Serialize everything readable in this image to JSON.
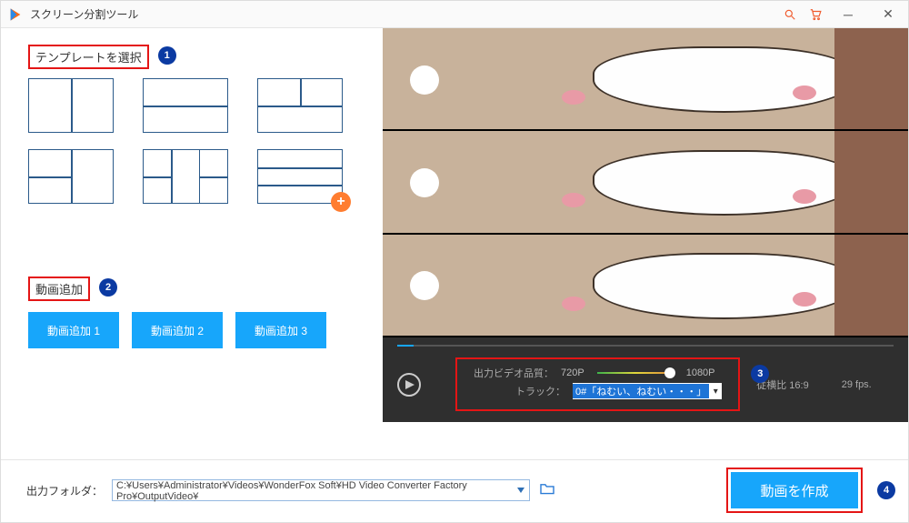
{
  "title": "スクリーン分割ツール",
  "left": {
    "select_template_label": "テンプレートを選択",
    "badge1": "1",
    "add_video_label": "動画追加",
    "badge2": "2",
    "add_buttons": [
      "動画追加 1",
      "動画追加 2",
      "動画追加 3"
    ]
  },
  "settings": {
    "quality_label": "出力ビデオ品質：",
    "q720": "720P",
    "q1080": "1080P",
    "track_label": "トラック：",
    "track_value": "0#「ねむい、ねむい・・・」",
    "aspect_label": "従横比 16:9",
    "fps": "29 fps.",
    "badge3": "3"
  },
  "footer": {
    "out_label": "出力フォルダ：",
    "path": "C:¥Users¥Administrator¥Videos¥WonderFox Soft¥HD Video Converter Factory Pro¥OutputVideo¥",
    "create_label": "動画を作成",
    "badge4": "4"
  }
}
